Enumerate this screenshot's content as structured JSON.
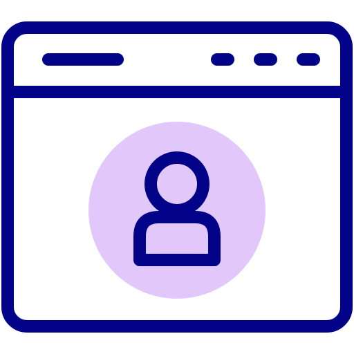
{
  "icon": {
    "name": "browser-user-profile-icon",
    "colors": {
      "stroke": "#020288",
      "fill": "#ffffff",
      "accent": "#e2c7fb"
    },
    "window": {
      "title_bar": {
        "controls": [
          "window-control",
          "window-control",
          "window-control"
        ]
      }
    },
    "content": {
      "avatar": "user-avatar-icon"
    }
  }
}
